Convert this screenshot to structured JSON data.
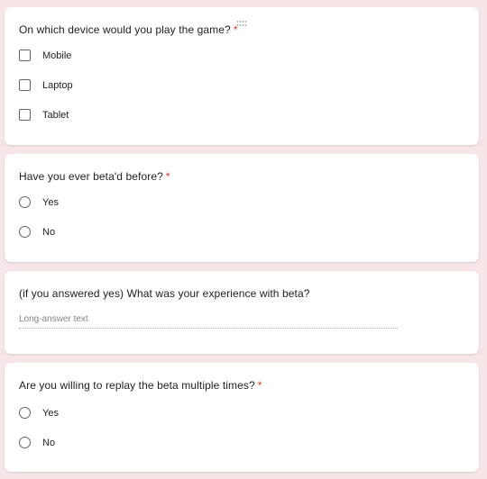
{
  "questions": [
    {
      "title": "On which device would you play the game?",
      "required_mark": "*",
      "type": "checkbox",
      "options": [
        "Mobile",
        "Laptop",
        "Tablet"
      ],
      "drag_icon": "drag-handle-icon"
    },
    {
      "title": "Have you ever beta'd before?",
      "required_mark": "*",
      "type": "radio",
      "options": [
        "Yes",
        "No"
      ]
    },
    {
      "title": "(if you answered yes) What was your experience with beta?",
      "type": "paragraph",
      "placeholder": "Long-answer text"
    },
    {
      "title": "Are you willing to replay the beta multiple times?",
      "required_mark": "*",
      "type": "radio",
      "options": [
        "Yes",
        "No"
      ]
    }
  ],
  "colors": {
    "background": "#f6e6e7",
    "card": "#ffffff",
    "required": "#d93025"
  }
}
